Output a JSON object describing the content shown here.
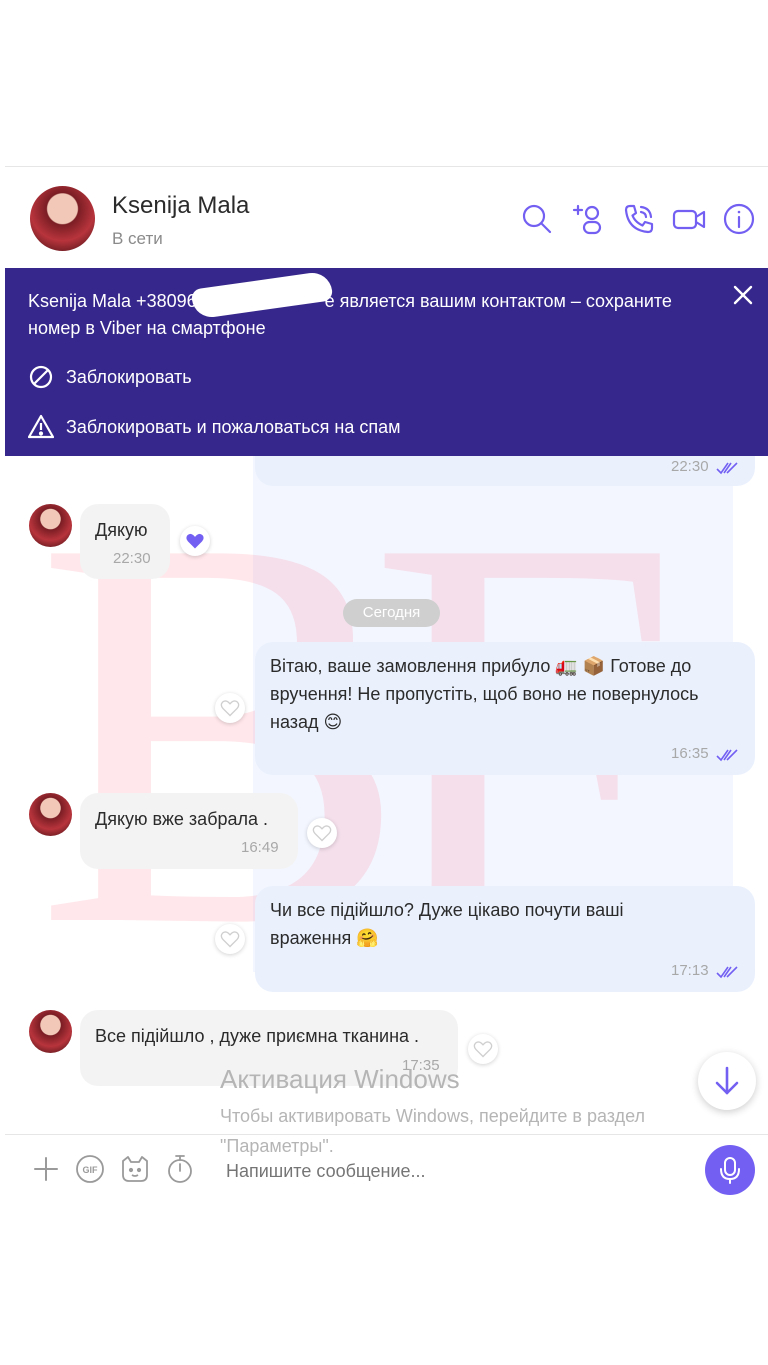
{
  "header": {
    "contact_name": "Ksenija Mala",
    "status": "В сети"
  },
  "banner": {
    "line1_prefix": "Ksenija Mala +380965",
    "line1_suffix": "е является вашим контактом – сохраните",
    "line2": "номер в Viber на смартфоне",
    "block_label": "Заблокировать",
    "block_spam_label": "Заблокировать и пожаловаться на спам"
  },
  "messages": [
    {
      "direction": "out",
      "time": "22:30",
      "read": true
    },
    {
      "direction": "in",
      "text": "Дякую",
      "time": "22:30",
      "reaction": "purple-heart"
    },
    {
      "date_separator": "Сегодня"
    },
    {
      "direction": "out",
      "line1": "Вітаю, ваше замовлення прибуло 🚛 📦  Готове до",
      "line2": "вручення! Не пропустіть, щоб воно не повернулось",
      "line3": "назад 😊",
      "time": "16:35",
      "read": true
    },
    {
      "direction": "in",
      "text": "Дякую вже забрала .",
      "time": "16:49"
    },
    {
      "direction": "out",
      "line1": "Чи все підійшло? Дуже цікаво почути ваші",
      "line2": "враження 🤗",
      "time": "17:13",
      "read": true
    },
    {
      "direction": "in",
      "text": "Все підійшло , дуже приємна тканина .",
      "time": "17:35"
    }
  ],
  "watermark": {
    "activation_title": "Активация Windows",
    "activation_text_1": "Чтобы активировать Windows, перейдите в раздел",
    "activation_text_2": "\"Параметры\"."
  },
  "composer": {
    "placeholder": "Напишите сообщение..."
  },
  "theme": {
    "accent": "#7360f2",
    "banner_bg": "#36278c",
    "bubble_out": "#eaf1fd",
    "bubble_in": "#f3f3f3"
  }
}
